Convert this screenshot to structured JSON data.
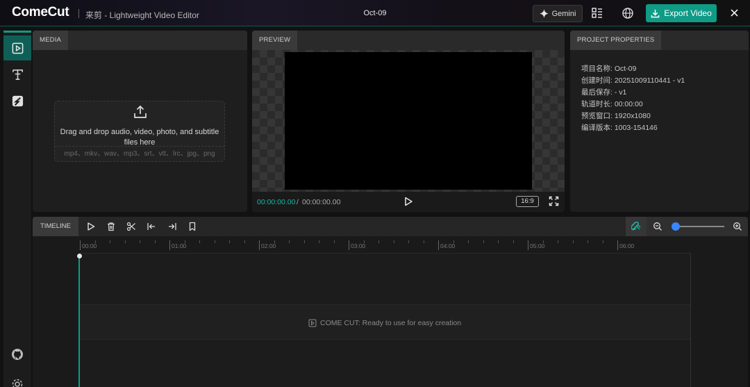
{
  "app": {
    "brand": "ComeCut",
    "subtitle": "来剪 - Lightweight Video Editor",
    "doc_title": "Oct-09"
  },
  "header": {
    "gemini_label": "Gemini",
    "export_label": "Export Video",
    "accent_color": "#0f9b86"
  },
  "rail": {
    "items": [
      {
        "name": "media",
        "icon": "play-square-icon",
        "active": true
      },
      {
        "name": "text",
        "icon": "text-icon",
        "active": false
      },
      {
        "name": "transition",
        "icon": "effect-icon",
        "active": false
      }
    ],
    "bottom": [
      {
        "name": "github",
        "icon": "github-icon"
      },
      {
        "name": "settings",
        "icon": "gear-icon"
      }
    ]
  },
  "media": {
    "tab": "MEDIA",
    "drop_text": "Drag and drop audio, video, photo, and subtitle files here",
    "formats": "mp4、mkv、wav、mp3、srt、vtt、lrc、jpg、png"
  },
  "preview": {
    "tab": "PREVIEW",
    "current_time": "00:00:00.00",
    "separator": "/",
    "duration": "00:00:00.00",
    "ratio": "16:9"
  },
  "properties": {
    "tab": "PROJECT PROPERTIES",
    "rows": [
      "项目名称:   Oct-09",
      "创建时间:   20251009110441 - v1",
      "最后保存:    - v1",
      "轨道时长:   00:00:00",
      "预览窗口:   1920x1080",
      "编译版本:   1003-154146"
    ]
  },
  "timeline": {
    "tab": "TIMELINE",
    "ruler_labels": [
      "00:00",
      "01:00",
      "02:00",
      "03:00",
      "04:00",
      "05:00",
      "06:00"
    ],
    "empty_message": "COME CUT: Ready to use for easy creation",
    "zoom_level": 0.05
  }
}
